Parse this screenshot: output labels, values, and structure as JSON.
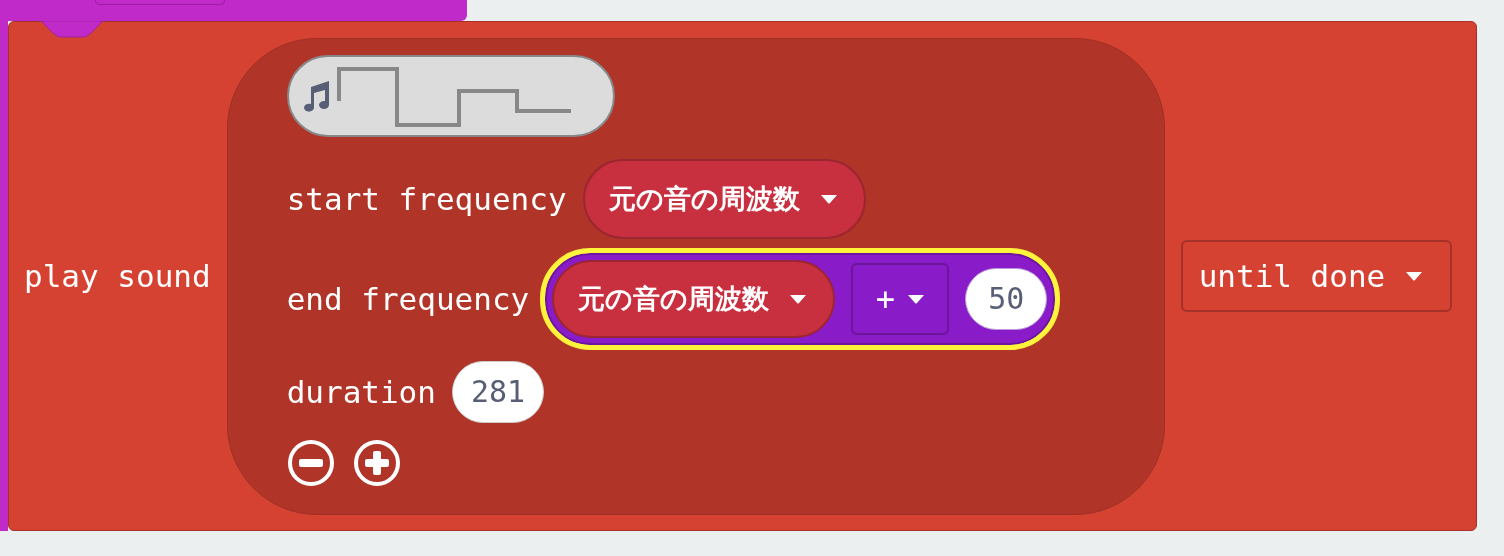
{
  "block": {
    "label": "play sound",
    "mode": "until done"
  },
  "sound": {
    "kind": "waveform"
  },
  "parameters": [
    {
      "label": "start frequency",
      "input": {
        "kind": "variable",
        "text": "元の音の周波数"
      }
    },
    {
      "label": "end frequency",
      "input": {
        "kind": "expression",
        "highlighted": true,
        "operands": [
          {
            "kind": "variable",
            "text": "元の音の周波数"
          },
          {
            "kind": "operator",
            "text": "+"
          },
          {
            "kind": "number",
            "text": "50"
          }
        ]
      }
    },
    {
      "label": "duration",
      "input": {
        "kind": "number",
        "text": "281"
      }
    }
  ]
}
